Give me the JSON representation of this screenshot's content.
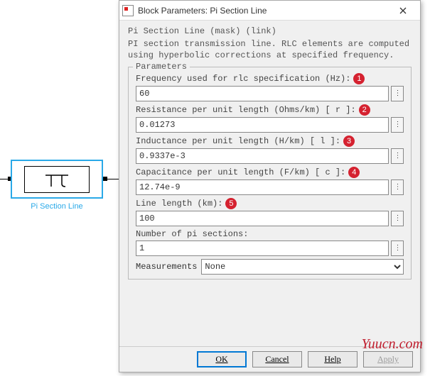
{
  "block": {
    "label": "Pi Section Line"
  },
  "dialog": {
    "title": "Block Parameters: Pi Section Line",
    "mask_line": "Pi Section Line (mask) (link)",
    "description": "PI section transmission line. RLC elements are computed using hyperbolic corrections at specified frequency.",
    "group_label": "Parameters",
    "fields": {
      "freq": {
        "label": "Frequency used for rlc specification (Hz):",
        "badge": "1",
        "value": "60"
      },
      "res": {
        "label": "Resistance per unit length (Ohms/km) [ r ]:",
        "badge": "2",
        "value": "0.01273"
      },
      "ind": {
        "label": "Inductance per unit length (H/km) [ l ]:",
        "badge": "3",
        "value": "0.9337e-3"
      },
      "cap": {
        "label": "Capacitance per unit length (F/km) [ c ]:",
        "badge": "4",
        "value": "12.74e-9"
      },
      "len": {
        "label": "Line length (km):",
        "badge": "5",
        "value": "100"
      },
      "npi": {
        "label": "Number of pi sections:",
        "value": "1"
      }
    },
    "measurements": {
      "label": "Measurements",
      "selected": "None"
    },
    "buttons": {
      "ok": "OK",
      "cancel": "Cancel",
      "help": "Help",
      "apply": "Apply"
    },
    "more": "⋮"
  },
  "watermark": "Yuucn.com"
}
